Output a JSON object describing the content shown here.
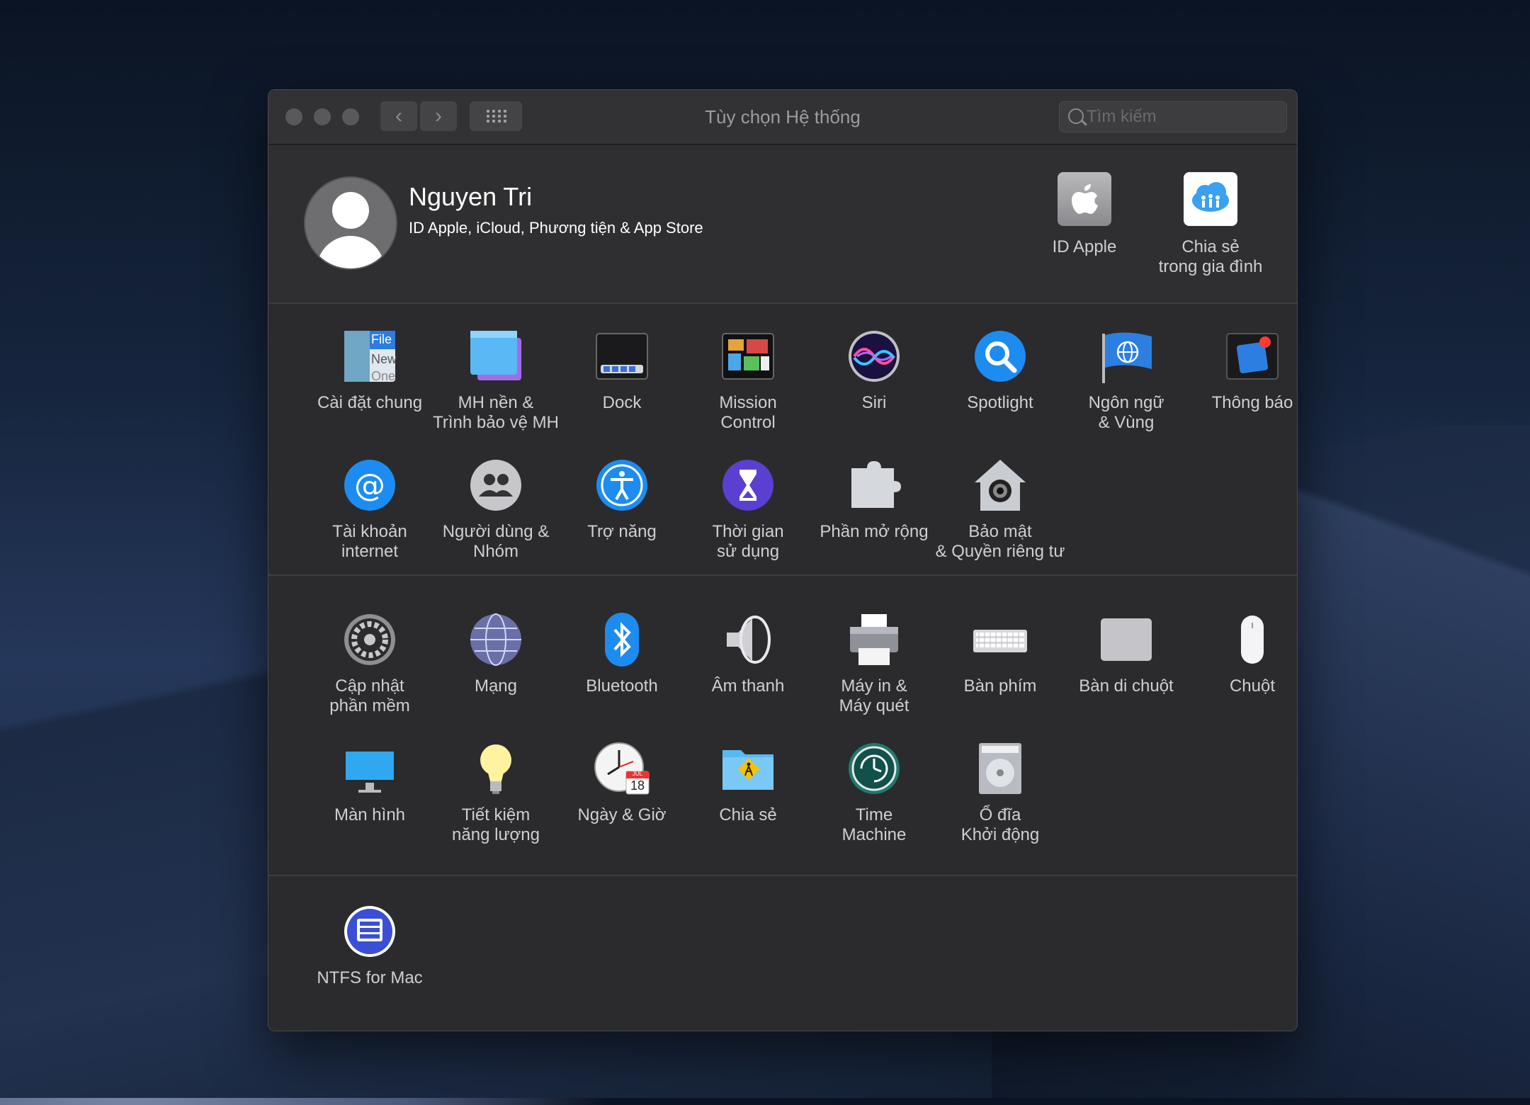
{
  "window": {
    "title": "Tùy chọn Hệ thống",
    "nav_back": "‹",
    "nav_forward": "›",
    "search_placeholder": "Tìm kiếm"
  },
  "profile": {
    "name": "Nguyen Tri",
    "subtitle": "ID Apple, iCloud, Phương tiện & App Store",
    "apple_id_label": "ID Apple",
    "family_sharing_label": [
      "Chia sẻ",
      "trong gia đình"
    ]
  },
  "section1": [
    {
      "name": "general",
      "icon": "general-icon",
      "label": [
        "Cài đặt chung"
      ],
      "badge": [
        "File",
        "New",
        "One"
      ]
    },
    {
      "name": "desktop-screensaver",
      "icon": "desktop-icon",
      "label": [
        "MH nền &",
        "Trình bảo vệ MH"
      ]
    },
    {
      "name": "dock",
      "icon": "dock-icon",
      "label": [
        "Dock"
      ]
    },
    {
      "name": "mission-control",
      "icon": "mission-control-icon",
      "label": [
        "Mission",
        "Control"
      ]
    },
    {
      "name": "siri",
      "icon": "siri-icon",
      "label": [
        "Siri"
      ]
    },
    {
      "name": "spotlight",
      "icon": "spotlight-icon",
      "label": [
        "Spotlight"
      ]
    },
    {
      "name": "language-region",
      "icon": "flag-icon",
      "label": [
        "Ngôn ngữ",
        "& Vùng"
      ]
    },
    {
      "name": "notifications",
      "icon": "notifications-icon",
      "label": [
        "Thông báo"
      ]
    },
    {
      "name": "internet-accounts",
      "icon": "at-icon",
      "label": [
        "Tài khoản",
        "internet"
      ]
    },
    {
      "name": "users-groups",
      "icon": "users-icon",
      "label": [
        "Người dùng &",
        "Nhóm"
      ]
    },
    {
      "name": "accessibility",
      "icon": "accessibility-icon",
      "label": [
        "Trợ năng"
      ]
    },
    {
      "name": "screen-time",
      "icon": "hourglass-icon",
      "label": [
        "Thời gian",
        "sử dụng"
      ]
    },
    {
      "name": "extensions",
      "icon": "puzzle-icon",
      "label": [
        "Phần mở rộng"
      ]
    },
    {
      "name": "security-privacy",
      "icon": "house-icon",
      "label": [
        "Bảo mật",
        "& Quyền riêng tư"
      ]
    }
  ],
  "section2": [
    {
      "name": "software-update",
      "icon": "gear-icon",
      "label": [
        "Cập nhật",
        "phần mềm"
      ]
    },
    {
      "name": "network",
      "icon": "globe-icon",
      "label": [
        "Mạng"
      ]
    },
    {
      "name": "bluetooth",
      "icon": "bluetooth-icon",
      "label": [
        "Bluetooth"
      ]
    },
    {
      "name": "sound",
      "icon": "speaker-icon",
      "label": [
        "Âm thanh"
      ]
    },
    {
      "name": "printers-scanners",
      "icon": "printer-icon",
      "label": [
        "Máy in &",
        "Máy quét"
      ]
    },
    {
      "name": "keyboard",
      "icon": "keyboard-icon",
      "label": [
        "Bàn phím"
      ]
    },
    {
      "name": "trackpad",
      "icon": "trackpad-icon",
      "label": [
        "Bàn di chuột"
      ]
    },
    {
      "name": "mouse",
      "icon": "mouse-icon",
      "label": [
        "Chuột"
      ]
    },
    {
      "name": "displays",
      "icon": "display-icon",
      "label": [
        "Màn hình"
      ]
    },
    {
      "name": "energy-saver",
      "icon": "bulb-icon",
      "label": [
        "Tiết kiệm",
        "năng lượng"
      ]
    },
    {
      "name": "date-time",
      "icon": "clock-icon",
      "label": [
        "Ngày & Giờ"
      ],
      "badge": [
        "JUL",
        "18"
      ]
    },
    {
      "name": "sharing",
      "icon": "sharing-folder-icon",
      "label": [
        "Chia sẻ"
      ]
    },
    {
      "name": "time-machine",
      "icon": "time-machine-icon",
      "label": [
        "Time",
        "Machine"
      ]
    },
    {
      "name": "startup-disk",
      "icon": "disk-icon",
      "label": [
        "Ổ đĩa",
        "Khởi động"
      ]
    }
  ],
  "section3": [
    {
      "name": "ntfs-for-mac",
      "icon": "ntfs-icon",
      "label": [
        "NTFS for Mac"
      ]
    }
  ]
}
